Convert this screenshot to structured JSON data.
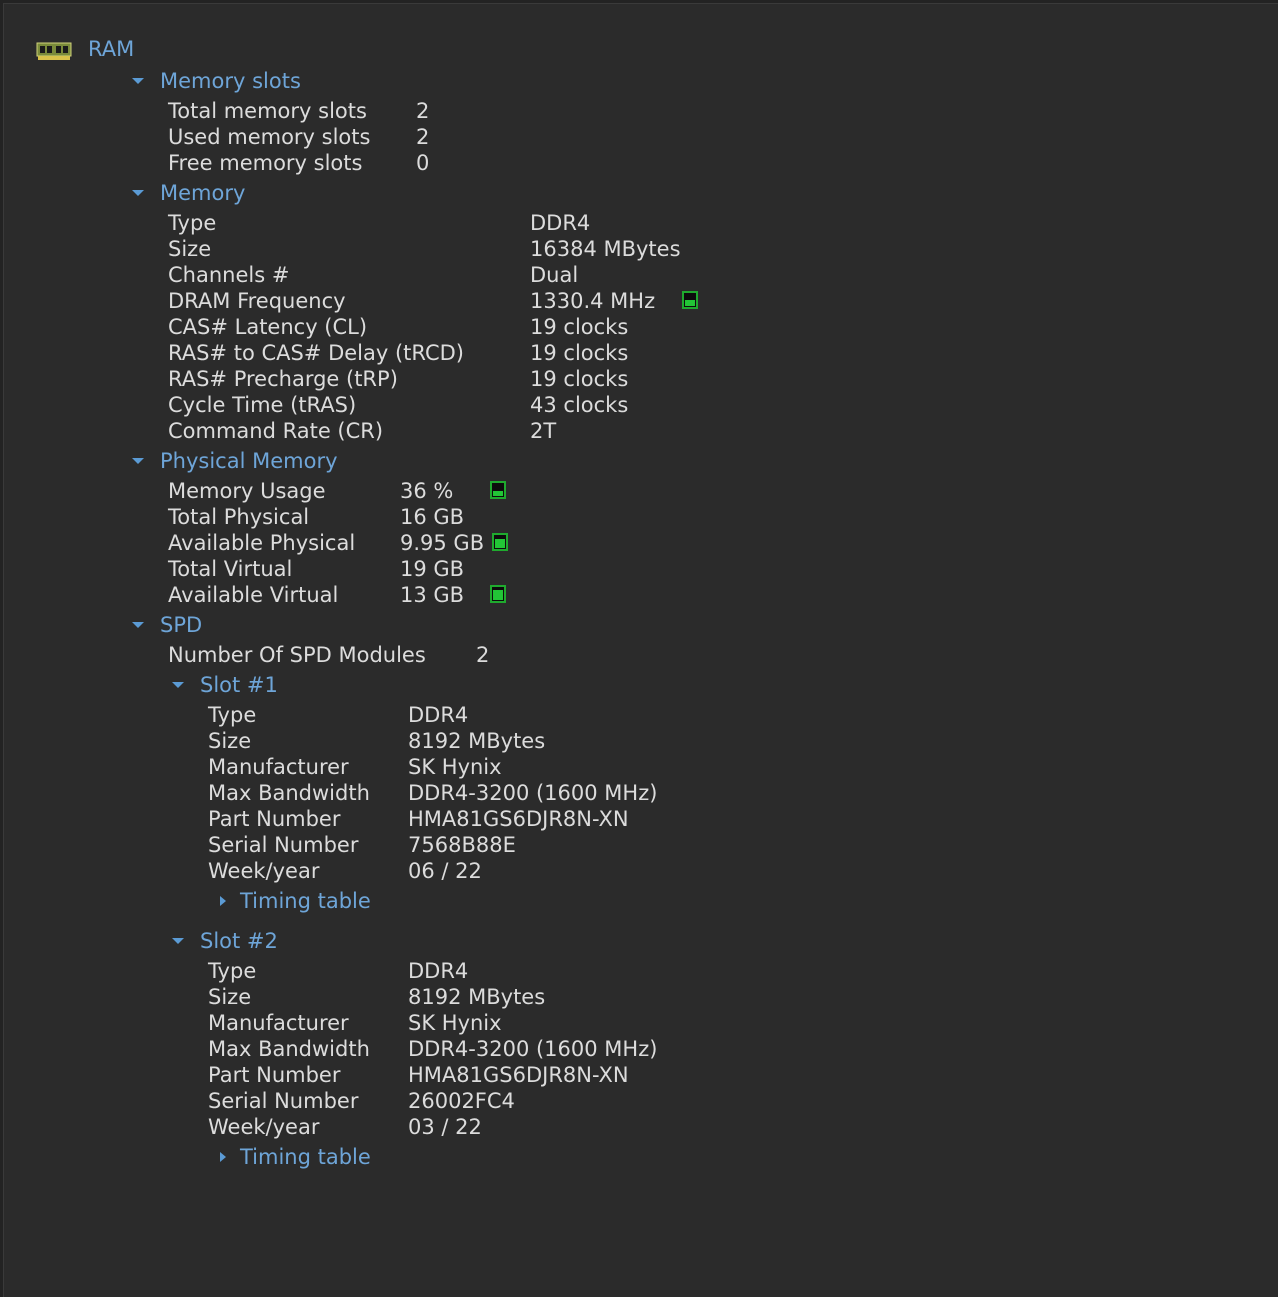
{
  "colors": {
    "background": "#2b2b2b",
    "text": "#dcdcdc",
    "section": "#6ea5d8",
    "meter": "#22c536"
  },
  "root": {
    "icon": "ram-module-icon",
    "title": "RAM"
  },
  "memory_slots": {
    "title": "Memory slots",
    "rows": [
      {
        "label": "Total memory slots",
        "value": "2"
      },
      {
        "label": "Used memory slots",
        "value": "2"
      },
      {
        "label": "Free memory slots",
        "value": "0"
      }
    ]
  },
  "memory": {
    "title": "Memory",
    "rows": [
      {
        "label": "Type",
        "value": "DDR4"
      },
      {
        "label": "Size",
        "value": "16384 MBytes"
      },
      {
        "label": "Channels #",
        "value": "Dual"
      },
      {
        "label": "DRAM Frequency",
        "value": "1330.4 MHz",
        "meter": 0.45
      },
      {
        "label": "CAS# Latency (CL)",
        "value": "19 clocks"
      },
      {
        "label": "RAS# to CAS# Delay (tRCD)",
        "value": "19 clocks"
      },
      {
        "label": "RAS# Precharge (tRP)",
        "value": "19 clocks"
      },
      {
        "label": "Cycle Time (tRAS)",
        "value": "43 clocks"
      },
      {
        "label": "Command Rate (CR)",
        "value": "2T"
      }
    ]
  },
  "physical_memory": {
    "title": "Physical Memory",
    "rows": [
      {
        "label": "Memory Usage",
        "value": "36 %",
        "meter": 0.36
      },
      {
        "label": "Total Physical",
        "value": "16 GB"
      },
      {
        "label": "Available Physical",
        "value": "9.95 GB",
        "meter": 0.62
      },
      {
        "label": "Total Virtual",
        "value": "19 GB"
      },
      {
        "label": "Available Virtual",
        "value": "13 GB",
        "meter": 0.68
      }
    ]
  },
  "spd": {
    "title": "SPD",
    "modules_label": "Number Of SPD Modules",
    "modules_value": "2",
    "slots": [
      {
        "title": "Slot #1",
        "rows": [
          {
            "label": "Type",
            "value": "DDR4"
          },
          {
            "label": "Size",
            "value": "8192 MBytes"
          },
          {
            "label": "Manufacturer",
            "value": "SK Hynix"
          },
          {
            "label": "Max Bandwidth",
            "value": "DDR4-3200 (1600 MHz)"
          },
          {
            "label": "Part Number",
            "value": "HMA81GS6DJR8N-XN"
          },
          {
            "label": "Serial Number",
            "value": "7568B88E"
          },
          {
            "label": "Week/year",
            "value": "06 / 22"
          }
        ],
        "timing_table": "Timing table"
      },
      {
        "title": "Slot #2",
        "rows": [
          {
            "label": "Type",
            "value": "DDR4"
          },
          {
            "label": "Size",
            "value": "8192 MBytes"
          },
          {
            "label": "Manufacturer",
            "value": "SK Hynix"
          },
          {
            "label": "Max Bandwidth",
            "value": "DDR4-3200 (1600 MHz)"
          },
          {
            "label": "Part Number",
            "value": "HMA81GS6DJR8N-XN"
          },
          {
            "label": "Serial Number",
            "value": "26002FC4"
          },
          {
            "label": "Week/year",
            "value": "03 / 22"
          }
        ],
        "timing_table": "Timing table"
      }
    ]
  }
}
